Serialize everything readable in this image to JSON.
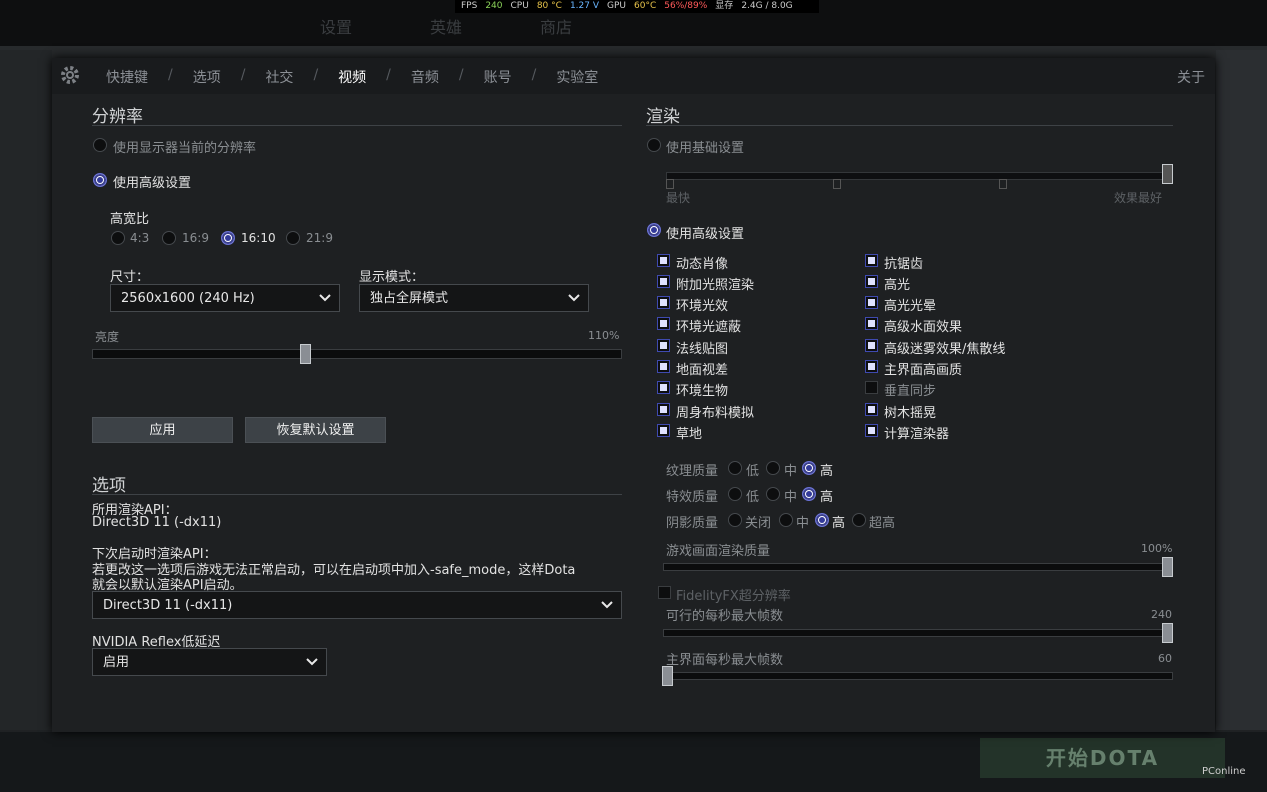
{
  "hud": {
    "fps_label": "FPS",
    "fps": "240",
    "cpu_label": "CPU",
    "cpu_temp": "80 °C",
    "cpu_volt": "1.27 V",
    "gpu_label": "GPU",
    "gpu_temp": "60°C",
    "gpu_util": "56%/89%",
    "vram_label": "显存",
    "vram": "2.4G / 8.0G"
  },
  "tabs": [
    "快捷键",
    "选项",
    "社交",
    "视频",
    "音频",
    "账号",
    "实验室"
  ],
  "active_tab": "视频",
  "about": "关于",
  "resolution": {
    "heading": "分辨率",
    "use_current": "使用显示器当前的分辨率",
    "use_advanced": "使用高级设置",
    "aspect_label": "高宽比",
    "aspects": [
      "4:3",
      "16:9",
      "16:10",
      "21:9"
    ],
    "size_label": "尺寸：",
    "size_value": "2560x1600 (240 Hz)",
    "display_mode_label": "显示模式：",
    "display_mode_value": "独占全屏模式",
    "brightness_label": "亮度",
    "brightness_value": "110%",
    "brightness_fraction": 0.4,
    "apply": "应用",
    "restore": "恢复默认设置"
  },
  "options": {
    "heading": "选项",
    "api_label": "所用渲染API：",
    "api_value": "Direct3D 11 (-dx11)",
    "next_api_label": "下次启动时渲染API：",
    "next_api_note_1": "若更改这一选项后游戏无法正常启动，可以在启动项中加入-safe_mode，这样Dota",
    "next_api_note_2": "就会以默认渲染API启动。",
    "next_api_value": "Direct3D 11 (-dx11)",
    "reflex_label": "NVIDIA Reflex低延迟",
    "reflex_value": "启用"
  },
  "render": {
    "heading": "渲染",
    "use_basic": "使用基础设置",
    "fastest": "最快",
    "best": "效果最好",
    "use_advanced": "使用高级设置",
    "left_checks": [
      "动态肖像",
      "附加光照渲染",
      "环境光效",
      "环境光遮蔽",
      "法线贴图",
      "地面视差",
      "环境生物",
      "周身布料模拟",
      "草地"
    ],
    "right_checks": [
      "抗锯齿",
      "高光",
      "高光光晕",
      "高级水面效果",
      "高级迷雾效果/焦散线",
      "主界面高画质",
      "垂直同步",
      "树木摇晃",
      "计算渲染器"
    ],
    "texture_label": "纹理质量",
    "effects_label": "特效质量",
    "shadow_label": "阴影质量",
    "low": "低",
    "mid": "中",
    "high": "高",
    "off": "关闭",
    "ultra": "超高",
    "render_quality_label": "游戏画面渲染质量",
    "render_quality_value": "100%",
    "fsr_label": "FidelityFX超分辨率",
    "max_fps_label": "可行的每秒最大帧数",
    "max_fps_value": "240",
    "menu_fps_label": "主界面每秒最大帧数",
    "menu_fps_value": "60"
  },
  "bottom": {
    "play": "开始DOTA",
    "watermark": "PConline"
  }
}
